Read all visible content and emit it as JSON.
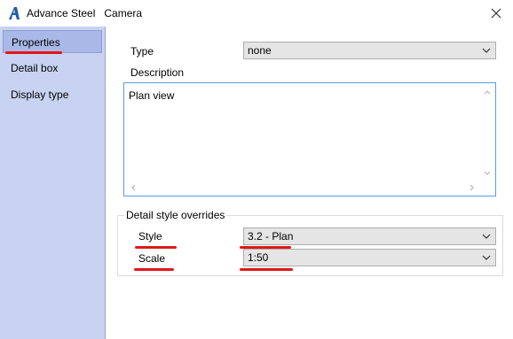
{
  "window": {
    "title": "Advance Steel   Camera",
    "app_icon": "advance-steel-logo-icon",
    "close_icon": "close-icon"
  },
  "sidebar": {
    "items": [
      {
        "label": "Properties",
        "active": true
      },
      {
        "label": "Detail box",
        "active": false
      },
      {
        "label": "Display type",
        "active": false
      }
    ]
  },
  "properties": {
    "type_label": "Type",
    "type_value": "none",
    "description_label": "Description",
    "description_value": "Plan view",
    "group_title": "Detail style overrides",
    "style_label": "Style",
    "style_value": "3.2 - Plan",
    "scale_label": "Scale",
    "scale_value": "1:50"
  },
  "colors": {
    "sidebar_bg": "#c8d3f2",
    "sidebar_active": "#a9b8e6",
    "focus_border": "#569de5",
    "annotation_red": "#e01818"
  }
}
